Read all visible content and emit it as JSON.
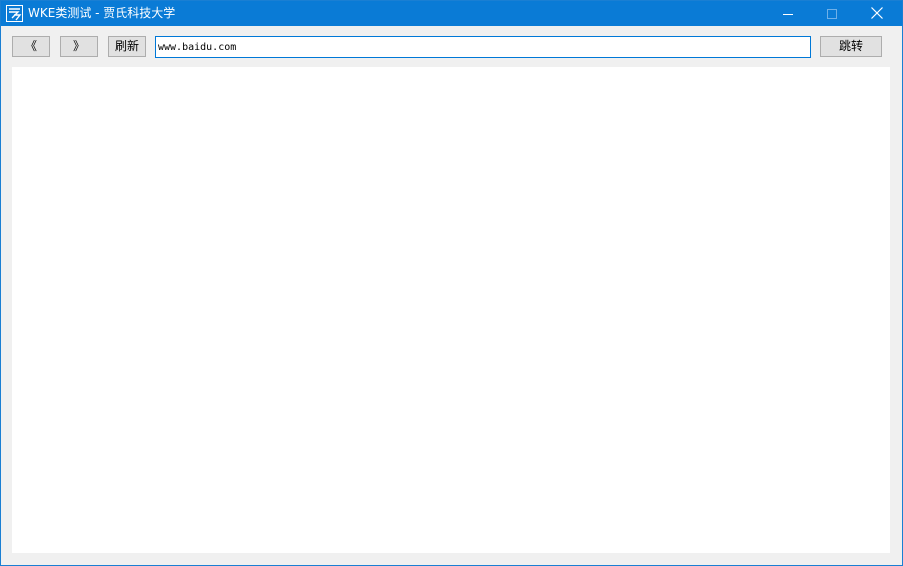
{
  "window": {
    "title": "WKE类测试 - 贾氏科技大学",
    "app_icon": "app-logo-icon",
    "controls": {
      "minimize_icon": "minimize-icon",
      "maximize_icon": "maximize-icon",
      "close_icon": "close-icon"
    }
  },
  "toolbar": {
    "back_label": "《",
    "forward_label": "》",
    "refresh_label": "刷新",
    "url_value": "www.baidu.com",
    "go_label": "跳转"
  },
  "colors": {
    "titlebar": "#0a7bd6",
    "window_border": "#1a7fd3",
    "input_focus_border": "#0078d7",
    "background": "#f0f0f0"
  }
}
